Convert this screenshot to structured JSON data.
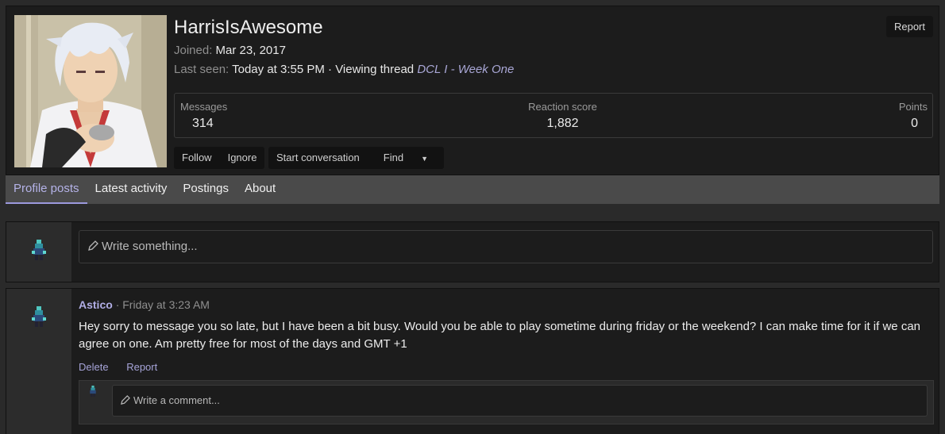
{
  "profile": {
    "username": "HarrisIsAwesome",
    "joined_label": "Joined:",
    "joined_value": "Mar 23, 2017",
    "last_seen_label": "Last seen:",
    "last_seen_value": "Today at 3:55 PM · Viewing thread",
    "last_seen_thread": "DCL I - Week One",
    "report_label": "Report",
    "stats": {
      "messages_label": "Messages",
      "messages_value": "314",
      "reaction_label": "Reaction score",
      "reaction_value": "1,882",
      "points_label": "Points",
      "points_value": "0"
    },
    "buttons": {
      "follow": "Follow",
      "ignore": "Ignore",
      "start_conversation": "Start conversation",
      "find": "Find"
    }
  },
  "tabs": [
    {
      "label": "Profile posts",
      "active": true
    },
    {
      "label": "Latest activity",
      "active": false
    },
    {
      "label": "Postings",
      "active": false
    },
    {
      "label": "About",
      "active": false
    }
  ],
  "composer": {
    "placeholder": "Write something..."
  },
  "post": {
    "author": "Astico",
    "time": "· Friday at 3:23 AM",
    "body": "Hey sorry to message you so late, but I have been a bit busy. Would you be able to play sometime during friday or the weekend? I can make time for it if we can agree on one. Am pretty free for most of the days and GMT +1",
    "actions": {
      "delete": "Delete",
      "report": "Report"
    },
    "comment_placeholder": "Write a comment..."
  },
  "colors": {
    "accent": "#9c99dd",
    "link": "#b1aee6",
    "panel": "#1c1c1c",
    "background": "#2a2a2a"
  }
}
